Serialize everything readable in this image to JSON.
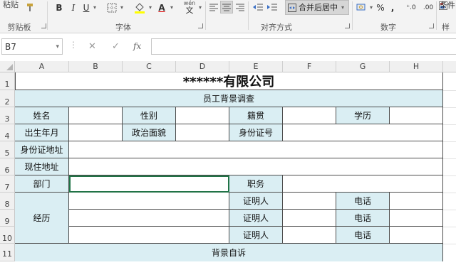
{
  "ribbon": {
    "paste": "粘贴",
    "bold": "B",
    "italic": "I",
    "underline": "U",
    "font_color_letter": "A",
    "wen": "wén",
    "wen_char": "文",
    "merge_center": "合并后居中",
    "percent": "%",
    "comma": ",",
    "dec_increase": "⁺.0",
    "dec_decrease": ".00",
    "conditional_format": "条件",
    "groups": {
      "clipboard": "剪贴板",
      "font": "字体",
      "alignment": "对齐方式",
      "number": "数字",
      "styles": "样"
    }
  },
  "formula_bar": {
    "name_box": "B7",
    "cancel": "✕",
    "enter": "✓",
    "fx": "fx",
    "value": ""
  },
  "columns": [
    "A",
    "B",
    "C",
    "D",
    "E",
    "F",
    "G",
    "H"
  ],
  "rows": [
    "1",
    "2",
    "3",
    "4",
    "5",
    "6",
    "7",
    "8",
    "9",
    "10",
    "11"
  ],
  "sheet": {
    "title": "******有限公司",
    "subtitle": "员工背景调查",
    "name": "姓名",
    "gender": "性别",
    "native_place": "籍贯",
    "education": "学历",
    "birth_date": "出生年月",
    "political_status": "政治面貌",
    "id_number": "身份证号",
    "id_address": "身份证地址",
    "current_address": "现住地址",
    "department": "部门",
    "position": "职务",
    "experience": "经历",
    "witness": "证明人",
    "phone": "电话",
    "background_statement": "背景自诉"
  }
}
